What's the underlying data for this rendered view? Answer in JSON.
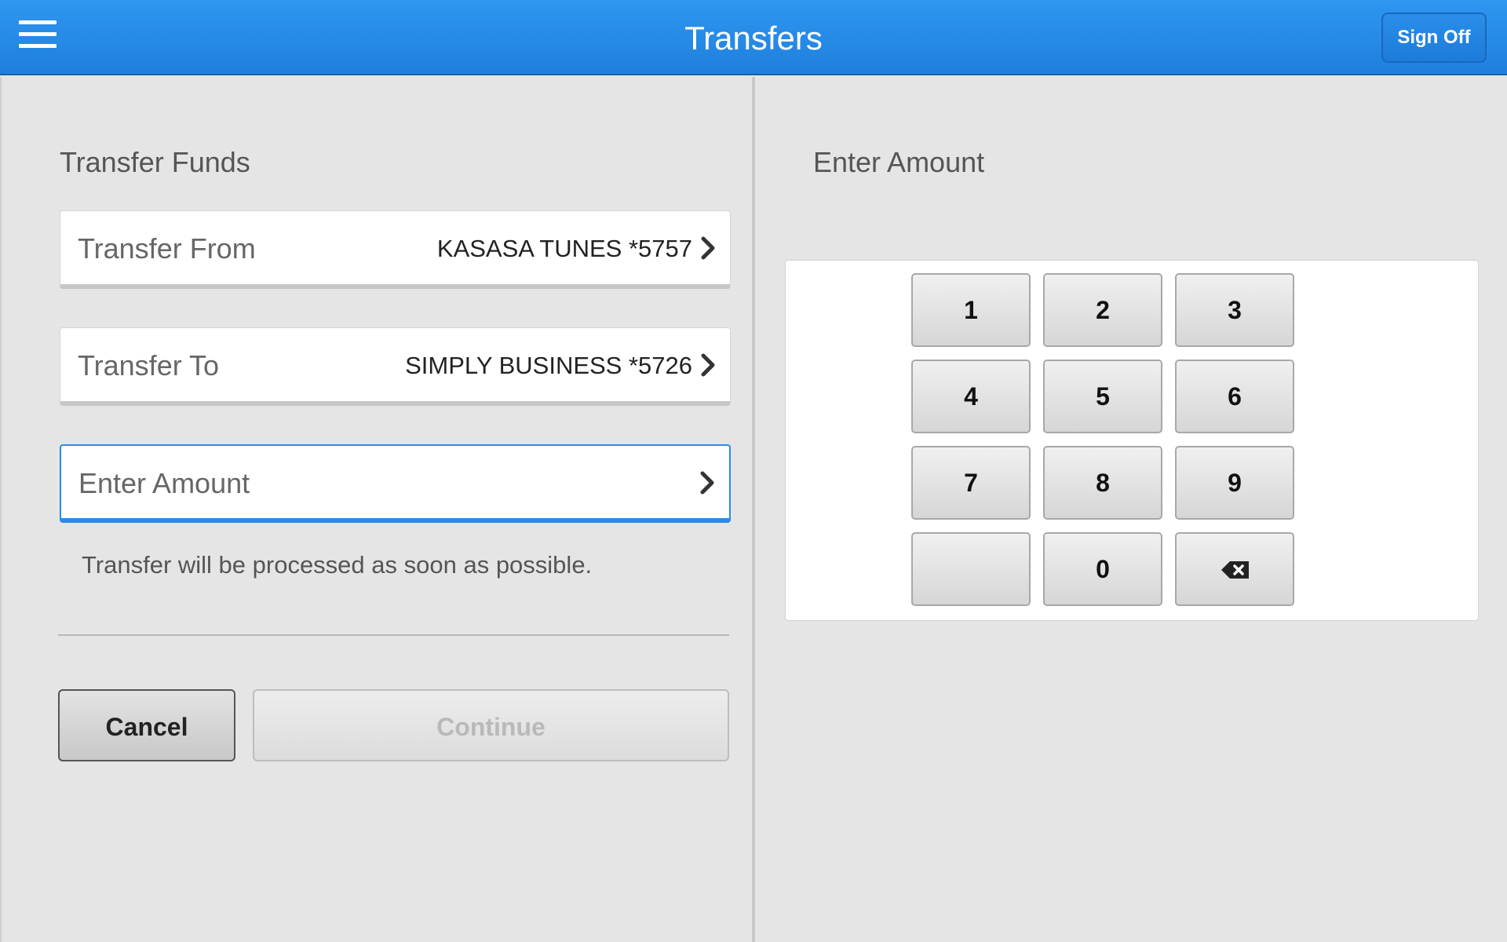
{
  "header": {
    "title": "Transfers",
    "sign_off_label": "Sign Off",
    "menu_icon": "hamburger-menu-icon"
  },
  "left": {
    "section_title": "Transfer Funds",
    "transfer_from": {
      "label": "Transfer From",
      "value": "KASASA TUNES *5757"
    },
    "transfer_to": {
      "label": "Transfer To",
      "value": "SIMPLY BUSINESS *5726"
    },
    "amount": {
      "label": "Enter Amount",
      "value": ""
    },
    "note": "Transfer will be processed as soon as possible.",
    "cancel_label": "Cancel",
    "continue_label": "Continue"
  },
  "right": {
    "section_title": "Enter Amount",
    "keys": {
      "k1": "1",
      "k2": "2",
      "k3": "3",
      "k4": "4",
      "k5": "5",
      "k6": "6",
      "k7": "7",
      "k8": "8",
      "k9": "9",
      "kblank": "",
      "k0": "0",
      "backspace_icon": "backspace-icon"
    }
  },
  "colors": {
    "header_blue": "#2388e6",
    "active_border": "#2b8be6",
    "panel_bg": "#e5e5e5",
    "disabled_text": "#b9b9b9"
  }
}
